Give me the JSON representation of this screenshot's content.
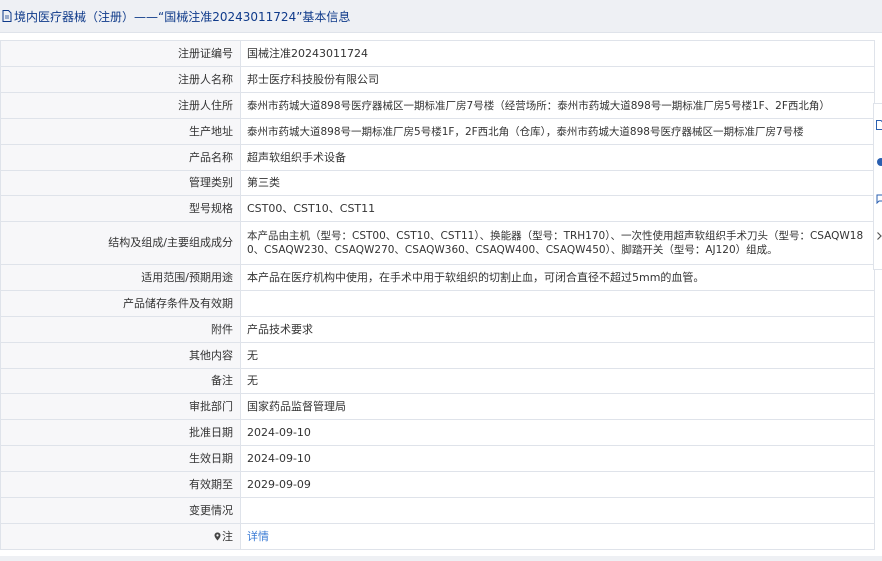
{
  "header": {
    "title": "境内医疗器械（注册）——“国械注准20243011724”基本信息"
  },
  "rows": [
    {
      "label": "注册证编号",
      "value": "国械注准20243011724"
    },
    {
      "label": "注册人名称",
      "value": "邦士医疗科技股份有限公司"
    },
    {
      "label": "注册人住所",
      "value": "泰州市药城大道898号医疗器械区一期标准厂房7号楼（经营场所：泰州市药城大道898号一期标准厂房5号楼1F、2F西北角）"
    },
    {
      "label": "生产地址",
      "value": "泰州市药城大道898号一期标准厂房5号楼1F，2F西北角（仓库），泰州市药城大道898号医疗器械区一期标准厂房7号楼"
    },
    {
      "label": "产品名称",
      "value": "超声软组织手术设备"
    },
    {
      "label": "管理类别",
      "value": "第三类"
    },
    {
      "label": "型号规格",
      "value": "CST00、CST10、CST11"
    },
    {
      "label": "结构及组成/主要组成成分",
      "value": "本产品由主机（型号：CST00、CST10、CST11）、换能器（型号：TRH170）、一次性使用超声软组织手术刀头（型号：CSAQW180、CSAQW230、CSAQW270、CSAQW360、CSAQW400、CSAQW450）、脚踏开关（型号：AJ120）组成。"
    },
    {
      "label": "适用范围/预期用途",
      "value": "本产品在医疗机构中使用，在手术中用于软组织的切割止血，可闭合直径不超过5mm的血管。"
    },
    {
      "label": "产品储存条件及有效期",
      "value": ""
    },
    {
      "label": "附件",
      "value": "产品技术要求"
    },
    {
      "label": "其他内容",
      "value": "无"
    },
    {
      "label": "备注",
      "value": "无"
    },
    {
      "label": "审批部门",
      "value": "国家药品监督管理局"
    },
    {
      "label": "批准日期",
      "value": "2024-09-10"
    },
    {
      "label": "生效日期",
      "value": "2024-09-10"
    },
    {
      "label": "有效期至",
      "value": "2029-09-09"
    },
    {
      "label": "变更情况",
      "value": ""
    },
    {
      "label": "注",
      "value": "详情",
      "icon": "map-pin-icon"
    }
  ],
  "colors": {
    "title_text": "#0f3a8a",
    "link": "#3a7bd5",
    "label_bg": "#f7f7f9",
    "border": "#dfe3ea",
    "header_bg": "#eef0f4"
  },
  "icons": {
    "title": "document-icon",
    "edge": [
      "document-icon",
      "circle-icon",
      "comment-icon",
      "chevron-right-icon"
    ]
  }
}
